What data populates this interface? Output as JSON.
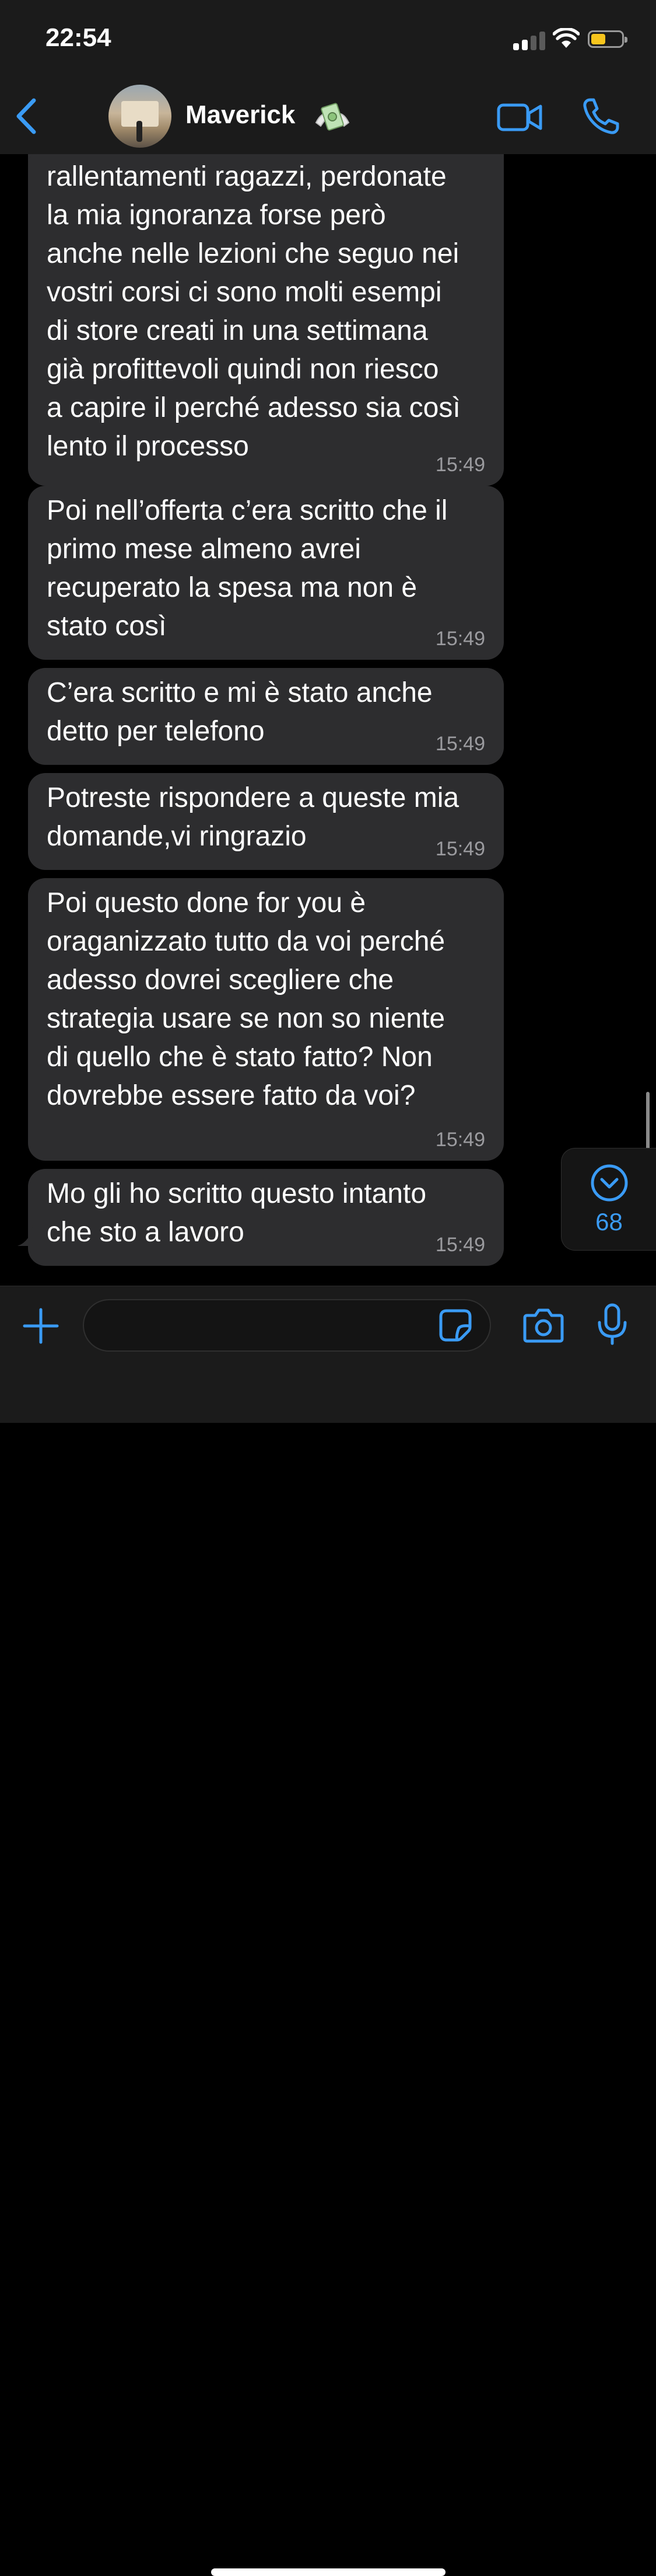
{
  "status_bar": {
    "time": "22:54"
  },
  "header": {
    "contact_name": "Maverick"
  },
  "messages": [
    {
      "partial_top": "rallentamenti ragazzi, perdonate\nla mia ignoranza forse però\nanche nelle lezioni che seguo nei\nvostri corsi ci sono molti esempi\ndi store creati in una settimana\ngià profittevoli quindi non riesco\na capire il perché adesso sia così\nlento il processo",
      "time": "15:49"
    },
    {
      "text": "Poi nell’offerta c’era scritto che il\nprimo mese almeno avrei\nrecuperato la spesa ma non è\nstato così",
      "time": "15:49"
    },
    {
      "text": "C’era scritto e mi è stato anche\ndetto per telefono",
      "time": "15:49"
    },
    {
      "text": "Potreste rispondere a queste mia\ndomande,vi ringrazio",
      "time": "15:49"
    },
    {
      "text": "Poi questo done for you è\noraganizzato tutto da voi perché\nadesso dovrei scegliere che\nstrategia usare se non so niente\ndi quello che è stato fatto? Non\ndovrebbe essere fatto da voi?",
      "time": "15:49"
    },
    {
      "text": "Mo gli ho scritto questo intanto\nche sto a lavoro",
      "time": "15:49"
    }
  ],
  "scroll_down": {
    "unread_count": "68"
  },
  "input_bar": {
    "message_value": ""
  },
  "colors": {
    "accent": "#3a9bf5",
    "bubble": "#2d2d2f",
    "timestamp": "#9b9b9f",
    "bar": "#1b1b1b"
  }
}
